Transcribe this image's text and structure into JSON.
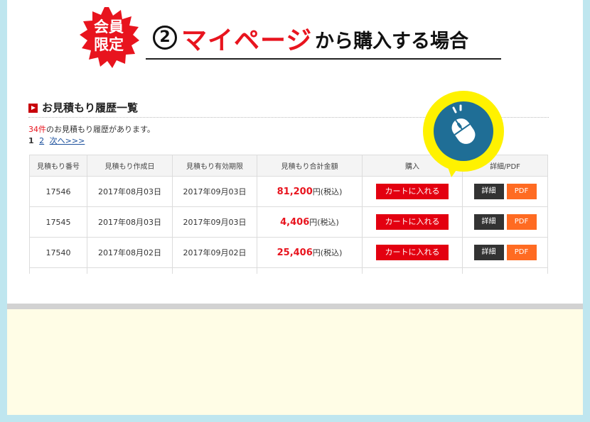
{
  "header": {
    "badge_line1": "会員",
    "badge_line2": "限定",
    "step_number": "②",
    "title_red": "マイページ",
    "title_black": "から購入する場合"
  },
  "section": {
    "title": "お見積もり履歴一覧",
    "count_number": "34件",
    "count_text": "のお見積もり履歴があります。",
    "pager": {
      "current": "1",
      "page2": "2",
      "next": "次へ>>>"
    }
  },
  "table": {
    "headers": [
      "見積もり番号",
      "見積もり作成日",
      "見積もり有効期限",
      "見積もり合計金額",
      "購入",
      "詳細/PDF"
    ],
    "rows": [
      {
        "id": "17546",
        "created": "2017年08月03日",
        "expires": "2017年09月03日",
        "amount": "81,200",
        "yen": "円(税込)",
        "cart": "カートに入れる",
        "detail": "詳細",
        "pdf": "PDF"
      },
      {
        "id": "17545",
        "created": "2017年08月03日",
        "expires": "2017年09月03日",
        "amount": "4,406",
        "yen": "円(税込)",
        "cart": "カートに入れる",
        "detail": "詳細",
        "pdf": "PDF"
      },
      {
        "id": "17540",
        "created": "2017年08月02日",
        "expires": "2017年09月02日",
        "amount": "25,406",
        "yen": "円(税込)",
        "cart": "カートに入れる",
        "detail": "詳細",
        "pdf": "PDF"
      }
    ]
  },
  "colors": {
    "accent_red": "#e30010",
    "pdf_orange": "#ff6b22",
    "pin_yellow": "#fff200",
    "pin_blue": "#1f6e96",
    "background": "#bfe6ef",
    "cream": "#fffde6"
  },
  "icons": {
    "badge": "starburst-icon",
    "pin": "mouse-pin-icon",
    "section": "red-arrow-icon"
  }
}
